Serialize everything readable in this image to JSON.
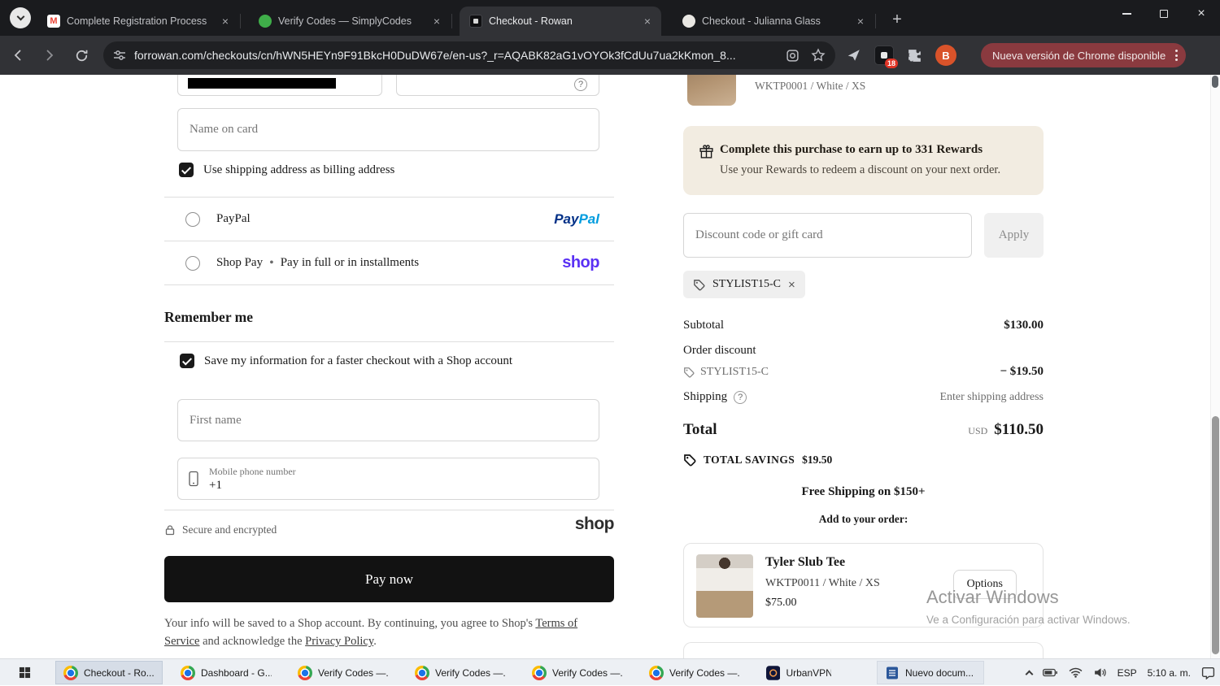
{
  "browser": {
    "tabs": [
      {
        "title": "Complete Registration Process"
      },
      {
        "title": "Verify Codes — SimplyCodes"
      },
      {
        "title": "Checkout - Rowan"
      },
      {
        "title": "Checkout - Julianna Glass"
      }
    ],
    "url": "forrowan.com/checkouts/cn/hWN5HEYn9F91BkcH0DuDW67e/en-us?_r=AQABK82aG1vOYOk3fCdUu7ua2kKmon_8...",
    "update_chip": "Nueva versión de Chrome disponible",
    "extension_badge": "18",
    "profile_initial": "B"
  },
  "glyphs": {
    "close": "×",
    "new_tab": "+",
    "gmail_m": "M",
    "help": "?"
  },
  "checkout": {
    "payment": {
      "name_on_card_placeholder": "Name on card",
      "billing_checkbox_label": "Use shipping address as billing address",
      "paypal_label": "PayPal",
      "paypal_logo_pay": "Pay",
      "paypal_logo_pal": "Pal",
      "shop_pay_label": "Shop Pay",
      "shop_pay_bullet": "•",
      "shop_pay_description": "Pay in full or in installments",
      "shop_logo": "shop"
    },
    "remember": {
      "heading": "Remember me",
      "save_checkbox_label": "Save my information for a faster checkout with a Shop account",
      "first_name_placeholder": "First name",
      "phone_label": "Mobile phone number",
      "phone_value": "+1"
    },
    "pay": {
      "secure_label": "Secure and encrypted",
      "shop_logo": "shop",
      "button_label": "Pay now",
      "footer_text_1": "Your info will be saved to a Shop account. By continuing, you agree to Shop's ",
      "terms_link": "Terms of Service",
      "footer_text_2": " and acknowledge the ",
      "privacy_link": "Privacy Policy",
      "footer_text_3": "."
    }
  },
  "summary": {
    "top_variant": "WKTP0001 / White / XS",
    "rewards_title": "Complete this purchase to earn up to 331 Rewards",
    "rewards_subtitle": "Use your Rewards to redeem a discount on your next order.",
    "discount_placeholder": "Discount code or gift card",
    "apply_button": "Apply",
    "applied_code": "STYLIST15-C",
    "subtotal_label": "Subtotal",
    "subtotal_value": "$130.00",
    "order_discount_label": "Order discount",
    "order_discount_code": "STYLIST15-C",
    "order_discount_value": "− $19.50",
    "shipping_label": "Shipping",
    "shipping_value": "Enter shipping address",
    "total_label": "Total",
    "currency": "USD",
    "total_value": "$110.50",
    "savings_label": "TOTAL SAVINGS",
    "savings_value": "$19.50",
    "free_shipping": "Free Shipping on $150+",
    "add_to_order": "Add to your order:",
    "upsell": {
      "name": "Tyler Slub Tee",
      "variant": "WKTP0011 / White / XS",
      "price": "$75.00",
      "options_button": "Options"
    }
  },
  "watermark": {
    "line1": "Activar Windows",
    "line2": "Ve a Configuración para activar Windows."
  },
  "taskbar": {
    "items": [
      {
        "label": "Checkout - Ro..."
      },
      {
        "label": "Dashboard - G..."
      },
      {
        "label": "Verify Codes —..."
      },
      {
        "label": "Verify Codes —..."
      },
      {
        "label": "Verify Codes —..."
      },
      {
        "label": "Verify Codes —..."
      },
      {
        "label": "UrbanVPN"
      },
      {
        "label": "Nuevo docum..."
      }
    ],
    "language": "ESP",
    "time": "5:10 a. m."
  },
  "colors": {
    "shop_purple": "#5a31f4",
    "paypal_dark": "#003087",
    "paypal_light": "#009cde",
    "pay_button": "#121212",
    "rewards_bg": "#f2ece1",
    "update_chip_bg": "#8a3a3f",
    "badge_red": "#e03426"
  }
}
